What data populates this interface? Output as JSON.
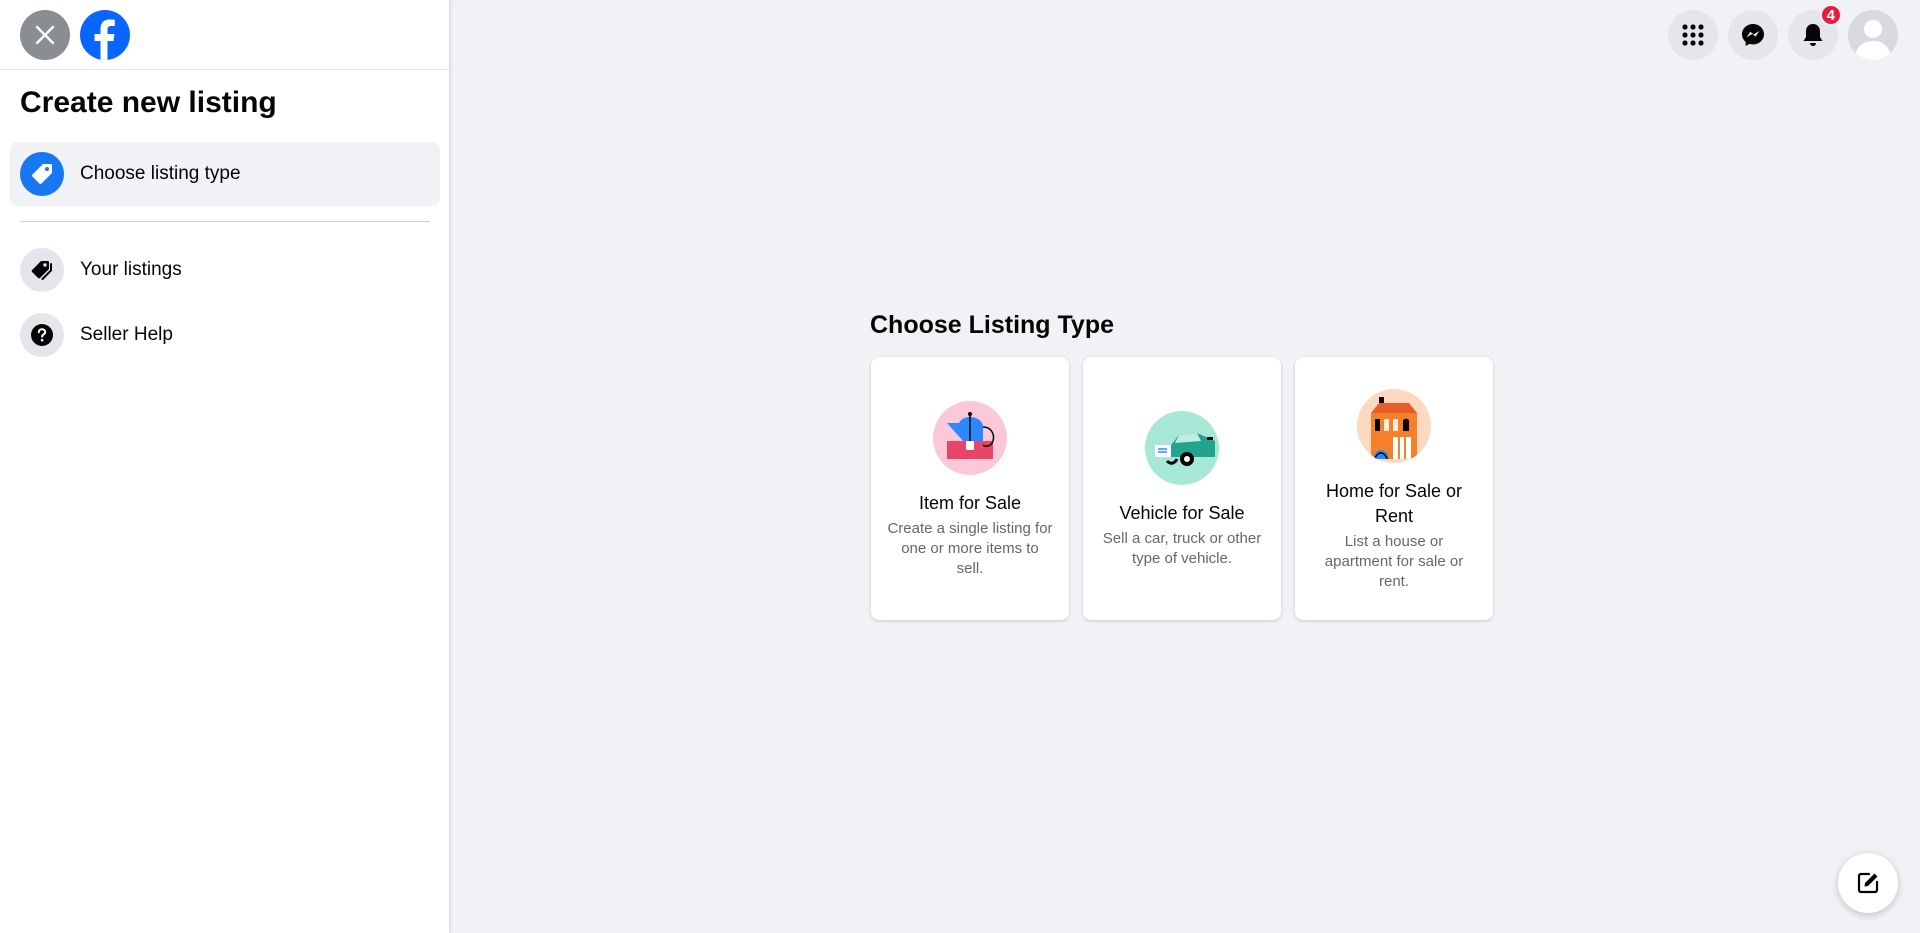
{
  "sidebar": {
    "title": "Create new listing",
    "items": [
      {
        "label": "Choose listing type",
        "icon": "tag-icon",
        "active": true
      },
      {
        "label": "Your listings",
        "icon": "tags-icon"
      },
      {
        "label": "Seller Help",
        "icon": "question-icon"
      }
    ]
  },
  "header": {
    "notifications_count": "4"
  },
  "main": {
    "title": "Choose Listing Type",
    "cards": [
      {
        "title": "Item for Sale",
        "description": "Create a single listing for one or more items to sell.",
        "icon": "item-for-sale-icon"
      },
      {
        "title": "Vehicle for Sale",
        "description": "Sell a car, truck or other type of vehicle.",
        "icon": "vehicle-icon"
      },
      {
        "title": "Home for Sale or Rent",
        "description": "List a house or apartment for sale or rent.",
        "icon": "house-icon"
      }
    ]
  },
  "colors": {
    "brand_blue": "#1877f2",
    "badge_red": "#e41e3f",
    "page_bg": "#f0f2f5"
  }
}
